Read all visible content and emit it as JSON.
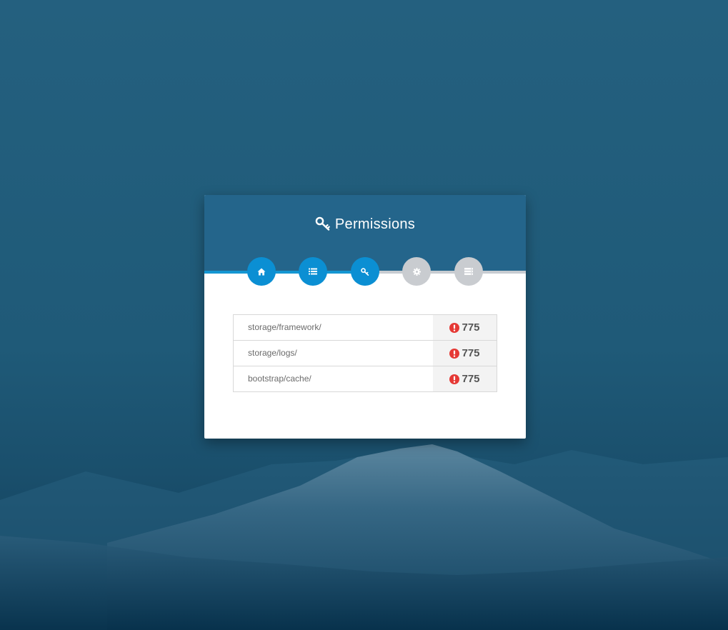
{
  "page": {
    "title": "Permissions",
    "title_icon": "key-icon"
  },
  "colors": {
    "header": "#24658b",
    "step_active": "#0b8fd3",
    "step_inactive": "#c9ccd0",
    "error": "#e53935"
  },
  "steps": [
    {
      "name": "home",
      "icon": "home-icon",
      "state": "active"
    },
    {
      "name": "requirements",
      "icon": "list-icon",
      "state": "active"
    },
    {
      "name": "permissions",
      "icon": "key-icon",
      "state": "active"
    },
    {
      "name": "environment",
      "icon": "gear-icon",
      "state": "inactive"
    },
    {
      "name": "install",
      "icon": "server-icon",
      "state": "inactive"
    }
  ],
  "progress": 0.5,
  "permissions": [
    {
      "path": "storage/framework/",
      "value": "775",
      "status_icon": "error-icon"
    },
    {
      "path": "storage/logs/",
      "value": "775",
      "status_icon": "error-icon"
    },
    {
      "path": "bootstrap/cache/",
      "value": "775",
      "status_icon": "error-icon"
    }
  ]
}
